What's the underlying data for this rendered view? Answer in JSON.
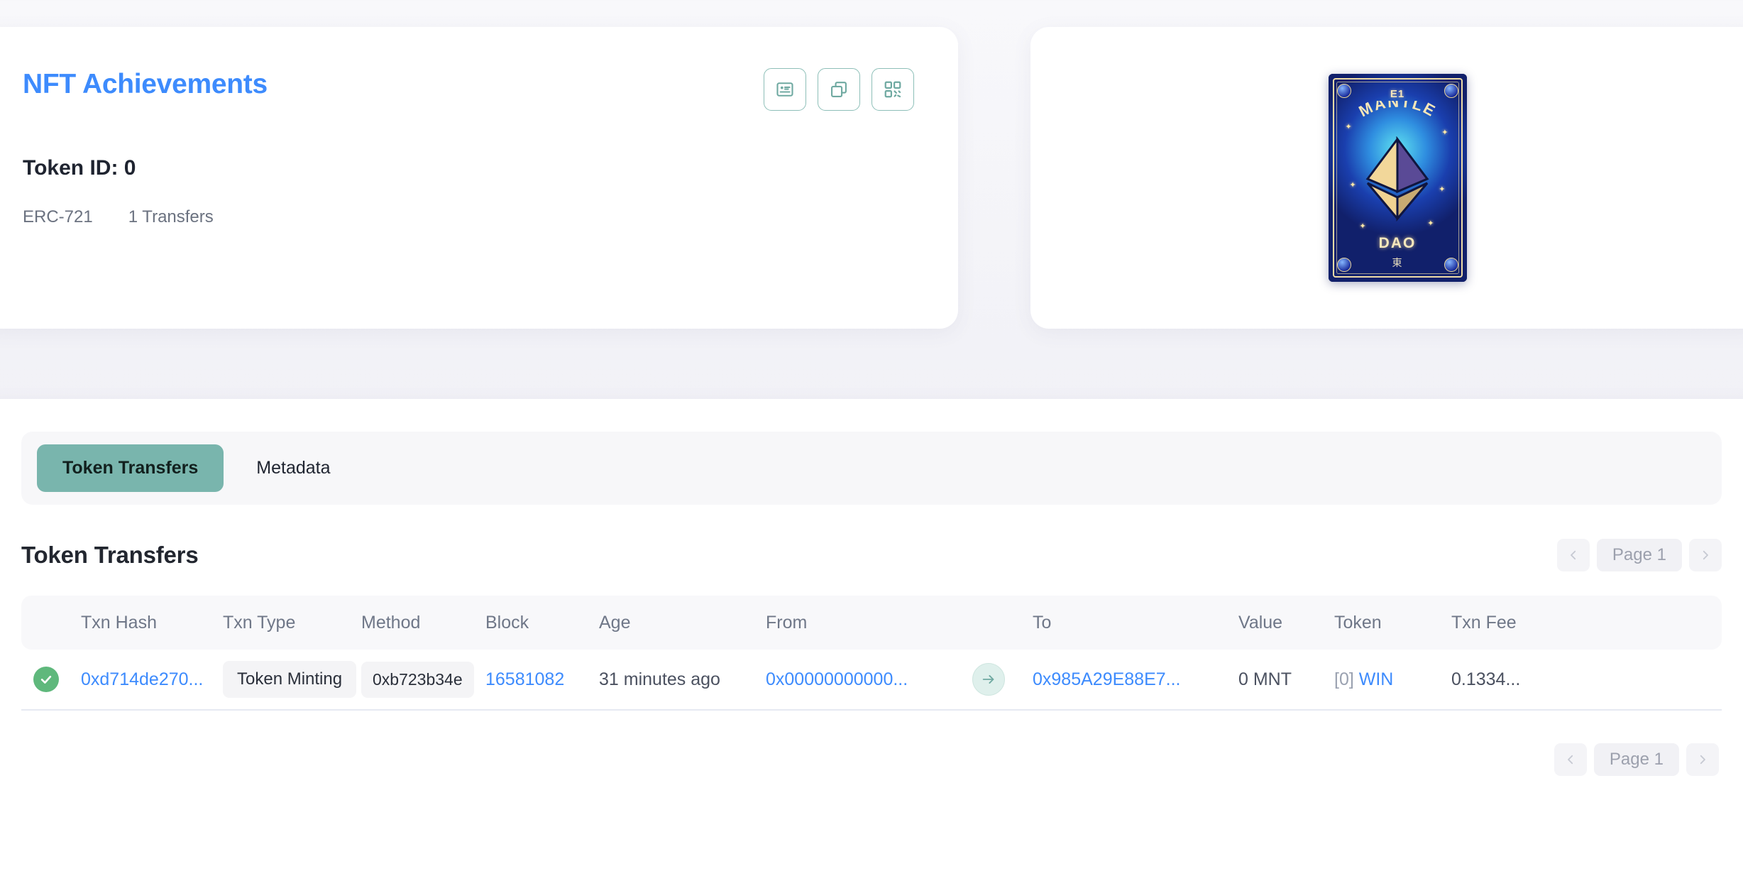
{
  "nft_card": {
    "title": "NFT Achievements",
    "token_id_label": "Token ID: 0",
    "standard": "ERC-721",
    "transfers": "1 Transfers",
    "actions": [
      {
        "name": "details-icon",
        "label": "Details"
      },
      {
        "name": "copy-icon",
        "label": "Copy"
      },
      {
        "name": "qr-code-icon",
        "label": "QR Code"
      }
    ]
  },
  "nft_art": {
    "top_label": "E1",
    "arc_label": "MANTLE",
    "bottom_label": "DAO",
    "cjk_label": "東",
    "colors": {
      "background": "#11206b",
      "glow": "#5fe3f0",
      "frame": "#f0dca6"
    }
  },
  "tabs": [
    {
      "label": "Token Transfers",
      "active": true
    },
    {
      "label": "Metadata",
      "active": false
    }
  ],
  "transfers_section": {
    "title": "Token Transfers",
    "pagination": {
      "prev_label": "‹",
      "page_label": "Page 1",
      "next_label": "›"
    },
    "columns": [
      "Txn Hash",
      "Txn Type",
      "Method",
      "Block",
      "Age",
      "From",
      "To",
      "Value",
      "Token",
      "Txn Fee"
    ],
    "rows": [
      {
        "status": "success",
        "txn_hash": "0xd714de270...",
        "txn_type": "Token Minting",
        "method": "0xb723b34e",
        "block": "16581082",
        "age": "31 minutes ago",
        "from": "0x00000000000...",
        "to": "0x985A29E88E7...",
        "value": "0 MNT",
        "token_index": "[0]",
        "token_symbol": "WIN",
        "txn_fee": "0.1334..."
      }
    ]
  },
  "theme": {
    "accent_blue": "#3d8bfd",
    "accent_teal": "#79b5ad",
    "success_green": "#5fb87c",
    "page_bg": "#f2f2f7"
  }
}
